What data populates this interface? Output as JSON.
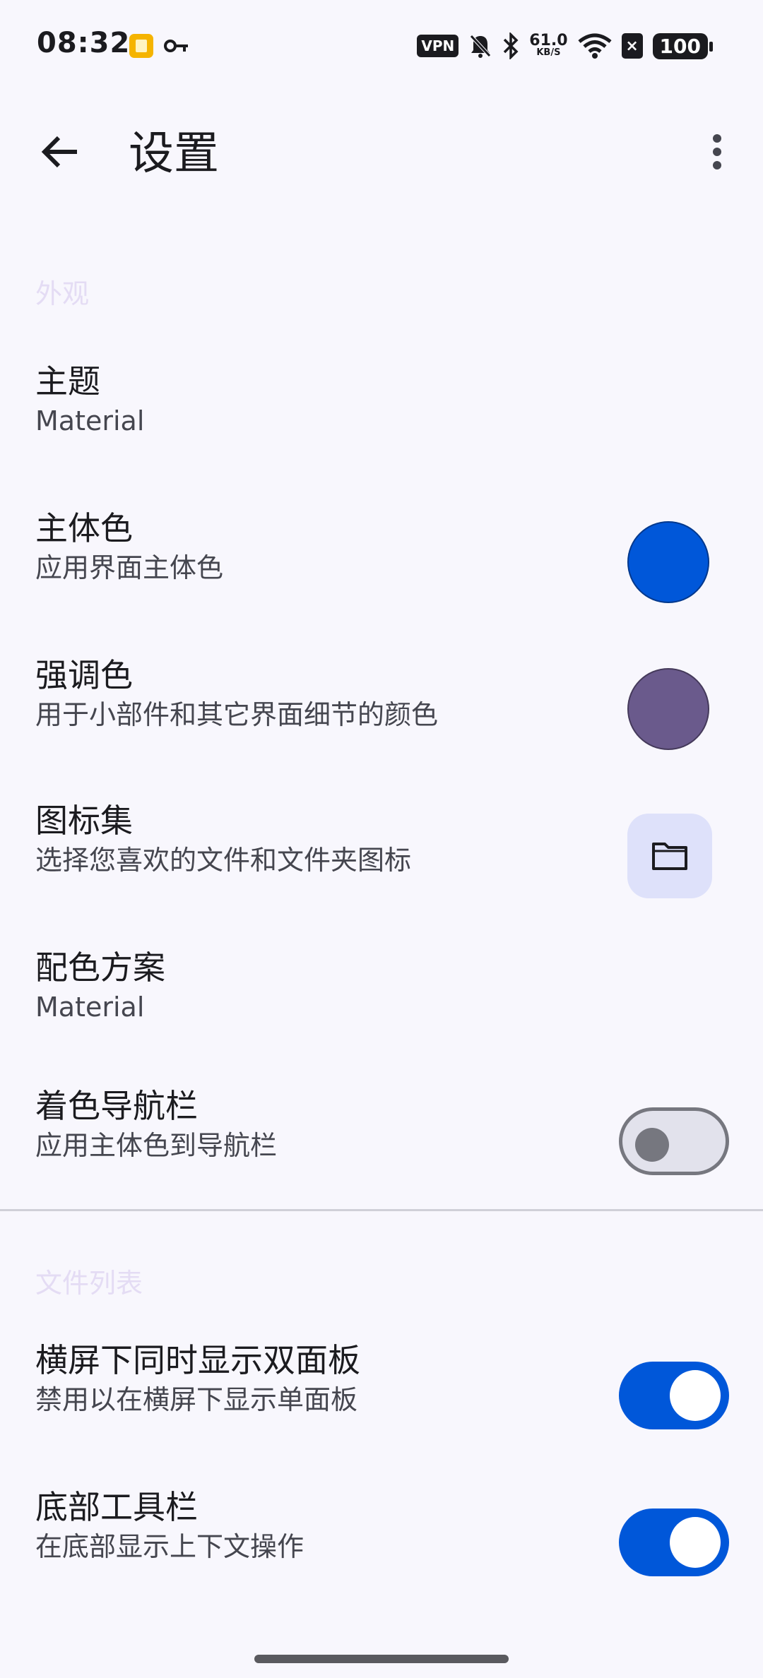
{
  "status_bar": {
    "time": "08:32",
    "vpn": "VPN",
    "net_speed": "61.0",
    "net_unit": "KB/S",
    "battery": "100",
    "icons": [
      "note-app-icon",
      "key-icon",
      "vpn-icon",
      "mute-bell-icon",
      "bluetooth-icon",
      "wifi-icon",
      "sim-off-icon",
      "battery-icon"
    ]
  },
  "app_bar": {
    "title": "设置",
    "icons": [
      "back-arrow-icon",
      "more-vert-icon"
    ]
  },
  "sections": {
    "appearance": {
      "header": "外观",
      "theme": {
        "title": "主题",
        "subtitle": "Material"
      },
      "primary_color": {
        "title": "主体色",
        "subtitle": "应用界面主体色",
        "swatch": "#0057d9"
      },
      "accent_color": {
        "title": "强调色",
        "subtitle": "用于小部件和其它界面细节的颜色",
        "swatch": "#6a5a8c"
      },
      "icon_set": {
        "title": "图标集",
        "subtitle": "选择您喜欢的文件和文件夹图标",
        "icon": "folder-icon"
      },
      "color_scheme": {
        "title": "配色方案",
        "subtitle": "Material"
      },
      "colored_nav_bar": {
        "title": "着色导航栏",
        "subtitle": "应用主体色到导航栏",
        "enabled": false
      }
    },
    "file_list": {
      "header": "文件列表",
      "dual_pane": {
        "title": "横屏下同时显示双面板",
        "subtitle": "禁用以在横屏下显示单面板",
        "enabled": true
      },
      "bottom_toolbar": {
        "title": "底部工具栏",
        "subtitle": "在底部显示上下文操作",
        "enabled": true
      }
    }
  },
  "colors": {
    "background": "#f8f7fd",
    "primary": "#0057d9",
    "section_header": "#e4dcf4"
  }
}
